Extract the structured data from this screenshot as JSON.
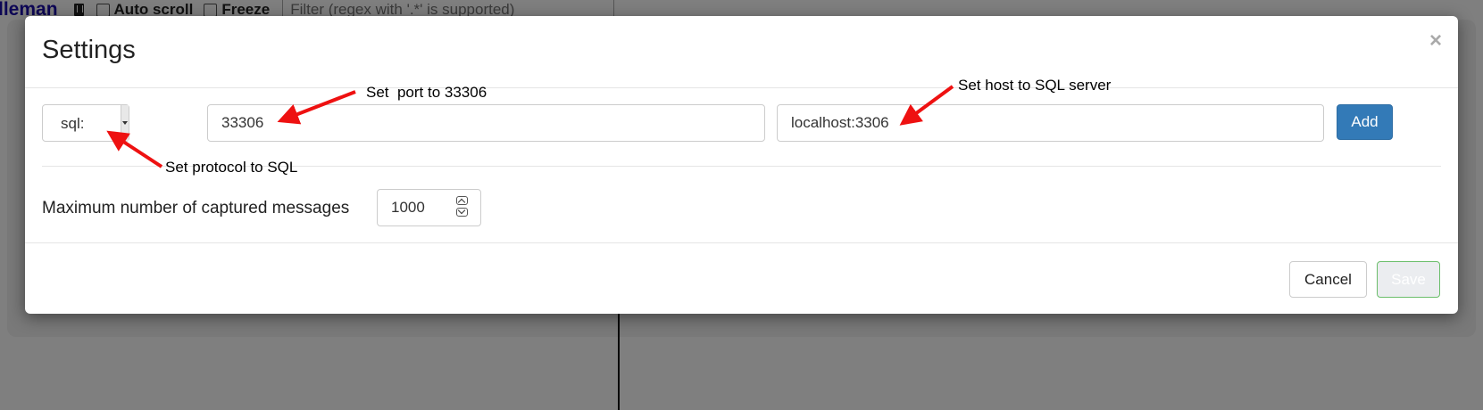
{
  "background": {
    "brand": "lleman",
    "auto_scroll_label": "Auto scroll",
    "freeze_label": "Freeze",
    "filter_placeholder": "Filter (regex with '.*' is supported)"
  },
  "modal": {
    "title": "Settings",
    "close_symbol": "×",
    "protocol_value": "sql:",
    "port_value": "33306",
    "host_value": "localhost:3306",
    "add_label": "Add",
    "max_messages_label": "Maximum number of captured messages",
    "max_messages_value": "1000",
    "cancel_label": "Cancel",
    "save_label": "Save"
  },
  "annotations": {
    "port_note": "Set  port to 33306",
    "host_note": "Set host to SQL server",
    "protocol_note": "Set protocol to SQL"
  },
  "colors": {
    "primary": "#337ab7",
    "annotation_arrow": "#ee1111",
    "save_border": "#5cb85c"
  }
}
